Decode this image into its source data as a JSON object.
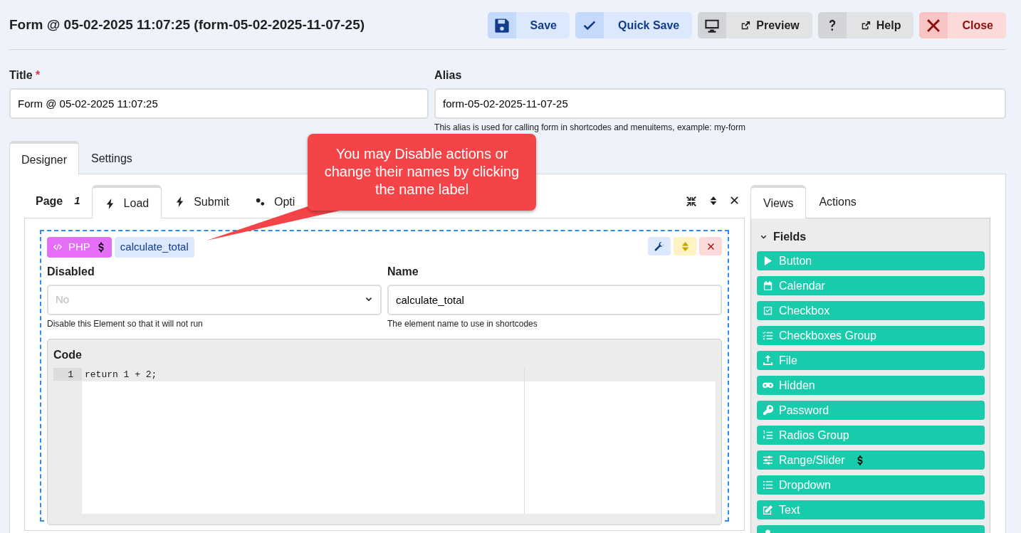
{
  "header": {
    "title": "Form @ 05-02-2025 11:07:25 (form-05-02-2025-11-07-25)",
    "buttons": [
      {
        "label": "Save",
        "kind": "save"
      },
      {
        "label": "Quick Save",
        "kind": "quicksave"
      },
      {
        "label": "Preview",
        "kind": "preview"
      },
      {
        "label": "Help",
        "kind": "help"
      },
      {
        "label": "Close",
        "kind": "close"
      }
    ]
  },
  "title_field": {
    "label": "Title",
    "required_mark": "*",
    "value": "Form @ 05-02-2025 11:07:25"
  },
  "alias_field": {
    "label": "Alias",
    "value": "form-05-02-2025-11-07-25",
    "help": "This alias is used for calling form in shortcodes and menuitems, example: my-form"
  },
  "main_tabs": [
    {
      "label": "Designer",
      "selected": true
    },
    {
      "label": "Settings",
      "selected": false
    }
  ],
  "page_label": "Page",
  "page_number": "1",
  "event_tabs": [
    {
      "label": "Load",
      "selected": true
    },
    {
      "label": "Submit",
      "selected": false
    },
    {
      "label": "Opti",
      "selected": false
    }
  ],
  "element": {
    "type_badge": "PHP",
    "name_badge": "calculate_total",
    "disabled": {
      "label": "Disabled",
      "placeholder": "No",
      "help": "Disable this Element so that it will not run"
    },
    "name": {
      "label": "Name",
      "value": "calculate_total",
      "help": "The element name to use in shortcodes"
    },
    "code": {
      "label": "Code",
      "lines": [
        {
          "number": "1",
          "text": "return 1 + 2;"
        }
      ]
    }
  },
  "side_tabs": [
    {
      "label": "Views",
      "selected": true
    },
    {
      "label": "Actions",
      "selected": false
    }
  ],
  "fields_group": {
    "label": "Fields",
    "expanded": true,
    "items": [
      {
        "label": "Button",
        "premium": false
      },
      {
        "label": "Calendar",
        "premium": false
      },
      {
        "label": "Checkbox",
        "premium": false
      },
      {
        "label": "Checkboxes Group",
        "premium": false
      },
      {
        "label": "File",
        "premium": false
      },
      {
        "label": "Hidden",
        "premium": false
      },
      {
        "label": "Password",
        "premium": false
      },
      {
        "label": "Radios Group",
        "premium": false
      },
      {
        "label": "Range/Slider",
        "premium": true
      },
      {
        "label": "Dropdown",
        "premium": false
      },
      {
        "label": "Text",
        "premium": false
      },
      {
        "premium": false
      }
    ]
  },
  "callout": {
    "text": "You may Disable actions or change their names by clicking the name label"
  }
}
